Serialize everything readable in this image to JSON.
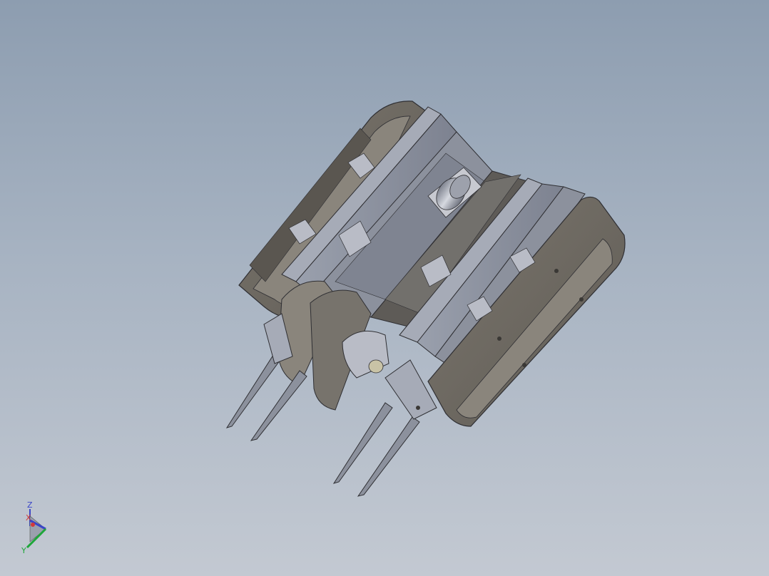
{
  "viewport": {
    "background_top": "#8d9db0",
    "background_bottom": "#c3c9d2"
  },
  "model": {
    "body_color": "#6e6a64",
    "face_color": "#8a857c",
    "plate_color": "#8c919d",
    "plate_light": "#a6abb7",
    "edge_color": "#2f2f33",
    "metal_color": "#b9bcc6"
  },
  "triad": {
    "axis_z": "Z",
    "axis_x": "X",
    "axis_y": "Y",
    "z_color": "#3a46c8",
    "x_color": "#d23a3a",
    "y_color": "#1ea63a"
  }
}
